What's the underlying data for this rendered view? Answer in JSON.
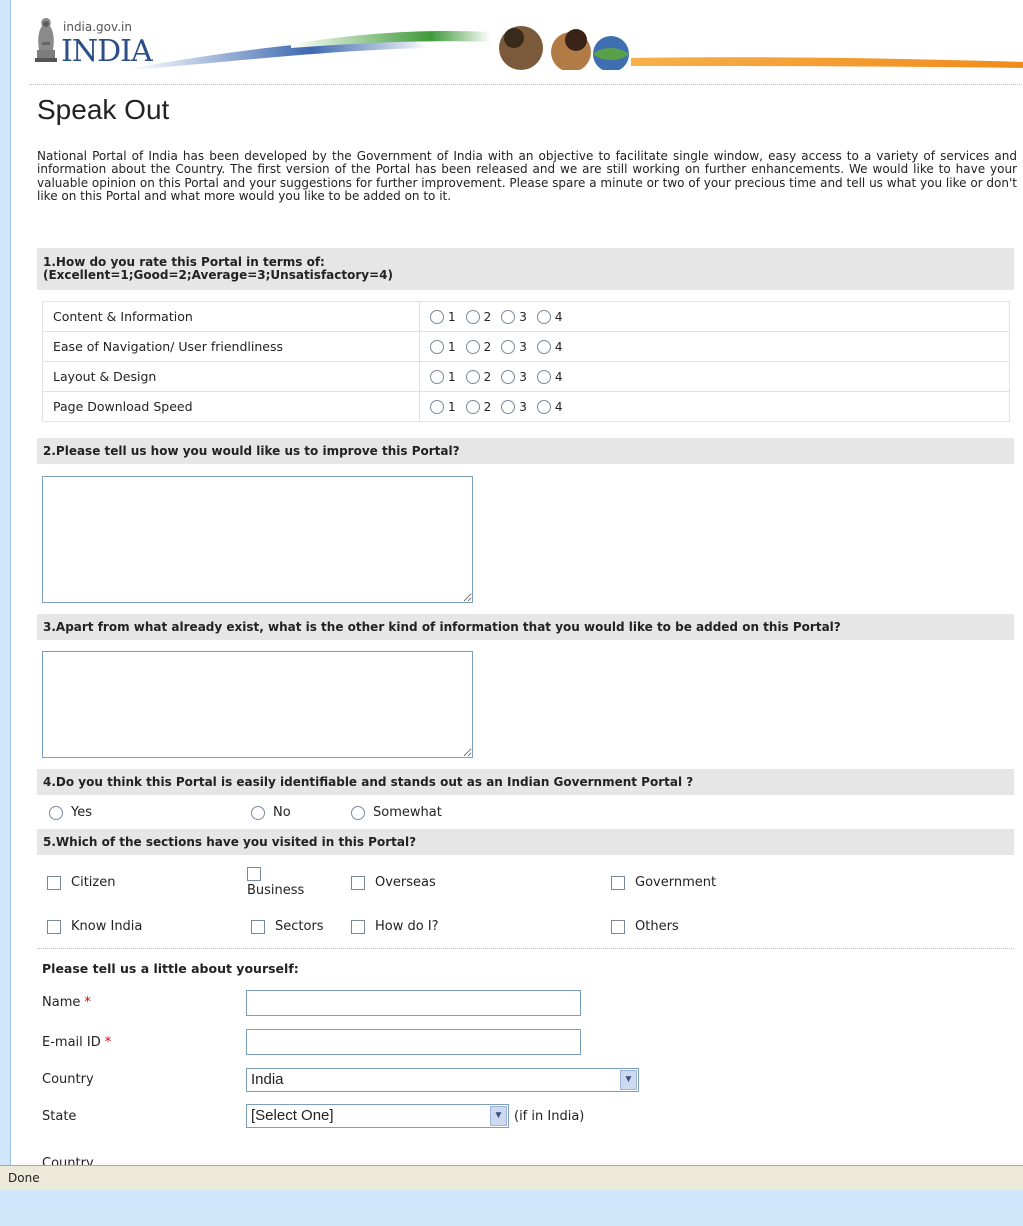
{
  "header": {
    "site_url": "india.gov.in",
    "site_name": "INDIA"
  },
  "page": {
    "title": "Speak Out",
    "intro": "National Portal of India has been developed by the Government of India with an objective to facilitate single window, easy access to a variety of services and information about the Country. The first version of the Portal has been released and we are still working on further enhancements. We would like to have your valuable opinion on this Portal and your suggestions for further improvement. Please spare a minute or two of your precious time and tell us what you like or don't like on this Portal and what more would you like to be added on to it."
  },
  "q1": {
    "title": "1.How do you rate this Portal in terms of:",
    "scale": "(Excellent=1;Good=2;Average=3;Unsatisfactory=4)",
    "rows": [
      "Content & Information",
      "Ease of Navigation/ User friendliness",
      "Layout & Design",
      "Page Download Speed"
    ],
    "options": [
      "1",
      "2",
      "3",
      "4"
    ]
  },
  "q2": {
    "title": "2.Please tell us how you would like us to improve  this Portal?"
  },
  "q3": {
    "title": "3.Apart from what already exist, what is the other kind of information that you would like to be added on this Portal?"
  },
  "q4": {
    "title": "4.Do you think this Portal is easily identifiable and stands out  as an Indian Government Portal ?",
    "options": [
      "Yes",
      "No",
      "Somewhat"
    ]
  },
  "q5": {
    "title": "5.Which of the sections have you visited in this Portal?",
    "sections": [
      "Citizen",
      "Business",
      "Overseas",
      "Government",
      "Know India",
      "Sectors",
      "How do I?",
      "Others"
    ]
  },
  "about": {
    "title": "Please tell us a little about yourself:",
    "name_label": "Name",
    "email_label": "E-mail ID",
    "required_mark": "*",
    "country_label": "Country",
    "country_value": "India",
    "state_label": "State",
    "state_value": "[Select One]",
    "state_hint": "(if in India)",
    "next_label_partial": "Country"
  },
  "status_bar": {
    "text": "Done"
  }
}
